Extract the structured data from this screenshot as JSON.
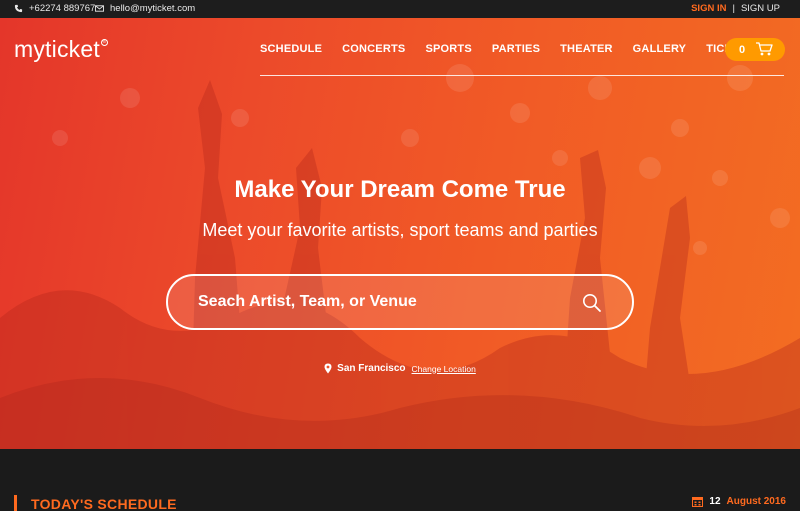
{
  "topbar": {
    "phone": "+62274 889767",
    "email": "hello@myticket.com",
    "sign_in": "SIGN IN",
    "separator": "|",
    "sign_up": "SIGN UP",
    "phone_icon": "phone-icon",
    "email_icon": "envelope-icon"
  },
  "header": {
    "logo": "myticket",
    "logo_mark": "®",
    "nav": [
      "SCHEDULE",
      "CONCERTS",
      "SPORTS",
      "PARTIES",
      "THEATER",
      "GALLERY",
      "TICEKTS"
    ],
    "cart_count": "0",
    "cart_icon": "cart-icon"
  },
  "hero": {
    "title": "Make Your Dream Come True",
    "subtitle": "Meet your favorite artists, sport teams and parties",
    "search_placeholder": "Seach Artist, Team, or Venue",
    "search_icon": "search-icon",
    "location_icon": "map-pin-icon",
    "location": "San Francisco",
    "change_location": "Change Location"
  },
  "schedule": {
    "title": "TODAY'S SCHEDULE",
    "calendar_icon": "calendar-icon",
    "day": "12",
    "month_year": "August 2016"
  },
  "colors": {
    "accent": "#ff6a1f",
    "cart_button": "#ff9a00",
    "dark_bg": "#1b1b1b"
  }
}
